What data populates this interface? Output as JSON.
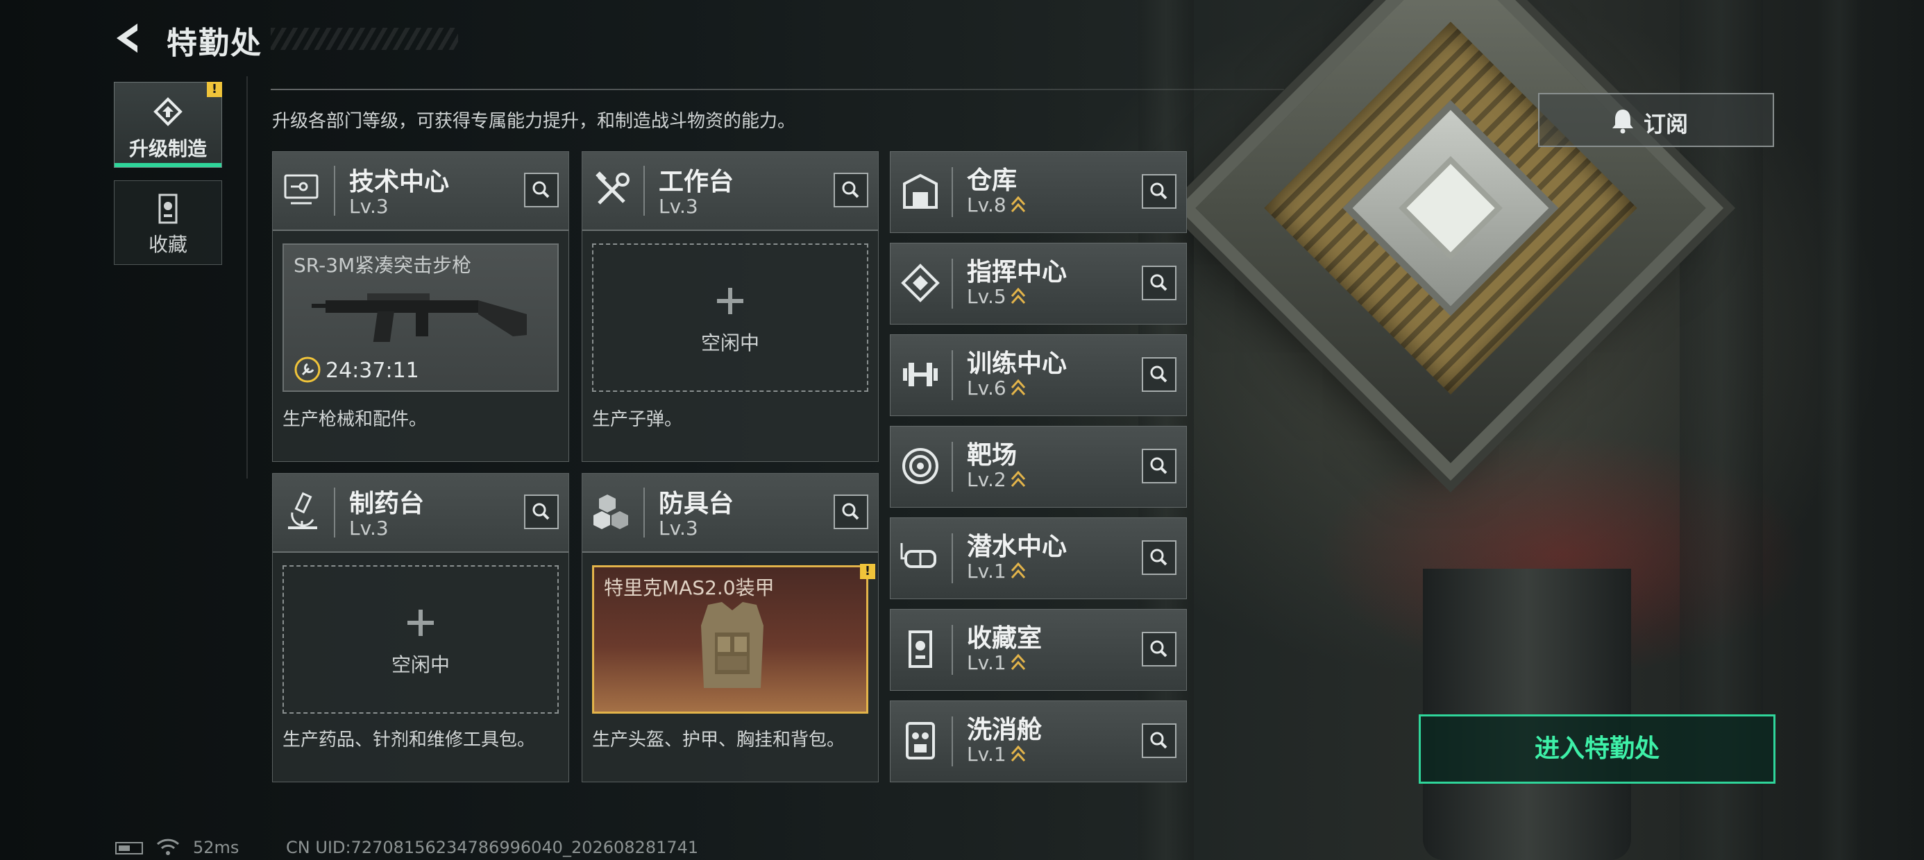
{
  "header": {
    "title": "特勤处"
  },
  "nav": {
    "items": [
      {
        "label": "升级制造",
        "icon": "upgrade-icon",
        "active": true,
        "alert": "!"
      },
      {
        "label": "收藏",
        "icon": "trophy-case-icon",
        "active": false
      }
    ]
  },
  "intro": "升级各部门等级，可获得专属能力提升，和制造战斗物资的能力。",
  "cards": [
    {
      "name": "技术中心",
      "level": "Lv.3",
      "icon": "computer-icon",
      "slot_state": "producing",
      "item_name": "SR-3M紧凑突击步枪",
      "timer": "24:37:11",
      "desc": "生产枪械和配件。"
    },
    {
      "name": "工作台",
      "level": "Lv.3",
      "icon": "tools-icon",
      "slot_state": "idle",
      "idle_text": "空闲中",
      "desc": "生产子弹。"
    },
    {
      "name": "制药台",
      "level": "Lv.3",
      "icon": "microscope-icon",
      "slot_state": "idle",
      "idle_text": "空闲中",
      "desc": "生产药品、针剂和维修工具包。"
    },
    {
      "name": "防具台",
      "level": "Lv.3",
      "icon": "blocks-icon",
      "slot_state": "done",
      "item_name": "特里克MAS2.0装甲",
      "alert": "!",
      "desc": "生产头盔、护甲、胸挂和背包。"
    }
  ],
  "rows": [
    {
      "name": "仓库",
      "level": "Lv.8",
      "icon": "warehouse-icon"
    },
    {
      "name": "指挥中心",
      "level": "Lv.5",
      "icon": "command-icon"
    },
    {
      "name": "训练中心",
      "level": "Lv.6",
      "icon": "dumbbell-icon"
    },
    {
      "name": "靶场",
      "level": "Lv.2",
      "icon": "target-icon"
    },
    {
      "name": "潜水中心",
      "level": "Lv.1",
      "icon": "diving-mask-icon"
    },
    {
      "name": "收藏室",
      "level": "Lv.1",
      "icon": "trophy-case-icon"
    },
    {
      "name": "洗消舱",
      "level": "Lv.1",
      "icon": "hazmat-icon"
    }
  ],
  "buttons": {
    "subscribe": "订阅",
    "enter": "进入特勤处"
  },
  "status": {
    "ping": "52ms",
    "uid": "CN UID:72708156234786996040_202608281741"
  },
  "colors": {
    "accent": "#2fd59a",
    "alert": "#f0c43a",
    "armor_border": "#e3b44a"
  }
}
